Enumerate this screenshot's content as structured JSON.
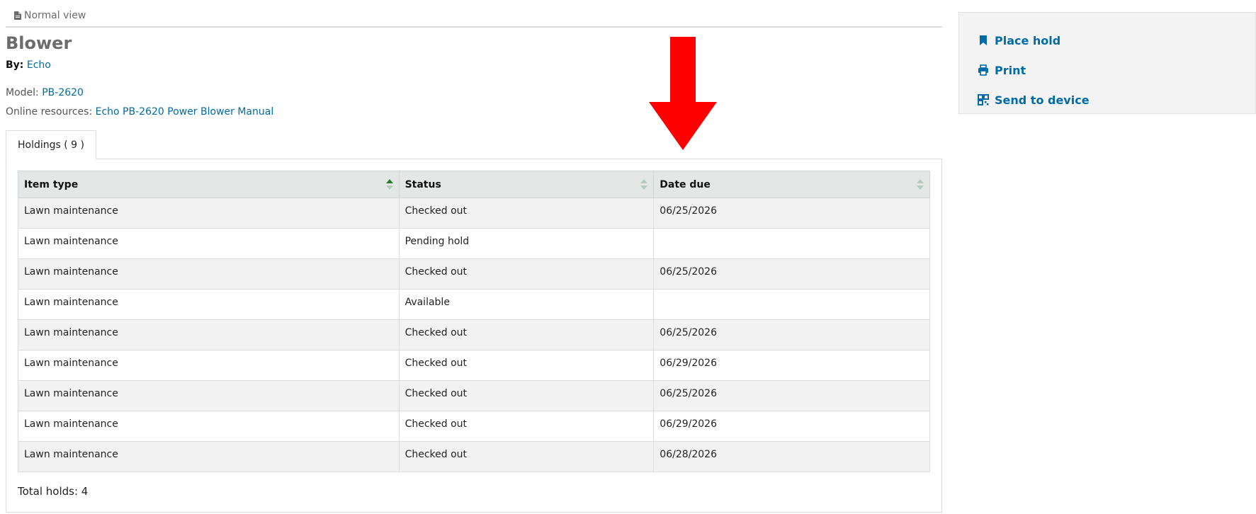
{
  "view_toggle": {
    "label": "Normal view",
    "icon": "document-icon"
  },
  "record": {
    "title": "Blower",
    "by_label": "By:",
    "author": "Echo",
    "model_label": "Model:",
    "model_value": "PB-2620",
    "online_label": "Online resources:",
    "online_link": "Echo PB-2620 Power Blower Manual"
  },
  "tabs": [
    {
      "label": "Holdings ( 9 )"
    }
  ],
  "holdings": {
    "headers": {
      "item_type": "Item type",
      "status": "Status",
      "date_due": "Date due"
    },
    "rows": [
      {
        "item_type": "Lawn maintenance",
        "status": "Checked out",
        "date_due": "06/25/2026"
      },
      {
        "item_type": "Lawn maintenance",
        "status": "Pending hold",
        "date_due": ""
      },
      {
        "item_type": "Lawn maintenance",
        "status": "Checked out",
        "date_due": "06/25/2026"
      },
      {
        "item_type": "Lawn maintenance",
        "status": "Available",
        "date_due": ""
      },
      {
        "item_type": "Lawn maintenance",
        "status": "Checked out",
        "date_due": "06/25/2026"
      },
      {
        "item_type": "Lawn maintenance",
        "status": "Checked out",
        "date_due": "06/29/2026"
      },
      {
        "item_type": "Lawn maintenance",
        "status": "Checked out",
        "date_due": "06/25/2026"
      },
      {
        "item_type": "Lawn maintenance",
        "status": "Checked out",
        "date_due": "06/29/2026"
      },
      {
        "item_type": "Lawn maintenance",
        "status": "Checked out",
        "date_due": "06/28/2026"
      }
    ],
    "total_holds": "Total holds: 4"
  },
  "sidebar": {
    "place_hold": "Place hold",
    "print": "Print",
    "send_to_device": "Send to device"
  },
  "colors": {
    "link": "#006ba6",
    "available": "#1a7a1a",
    "annotation_arrow": "#ff0000",
    "header_bg": "#e3e8e6"
  }
}
